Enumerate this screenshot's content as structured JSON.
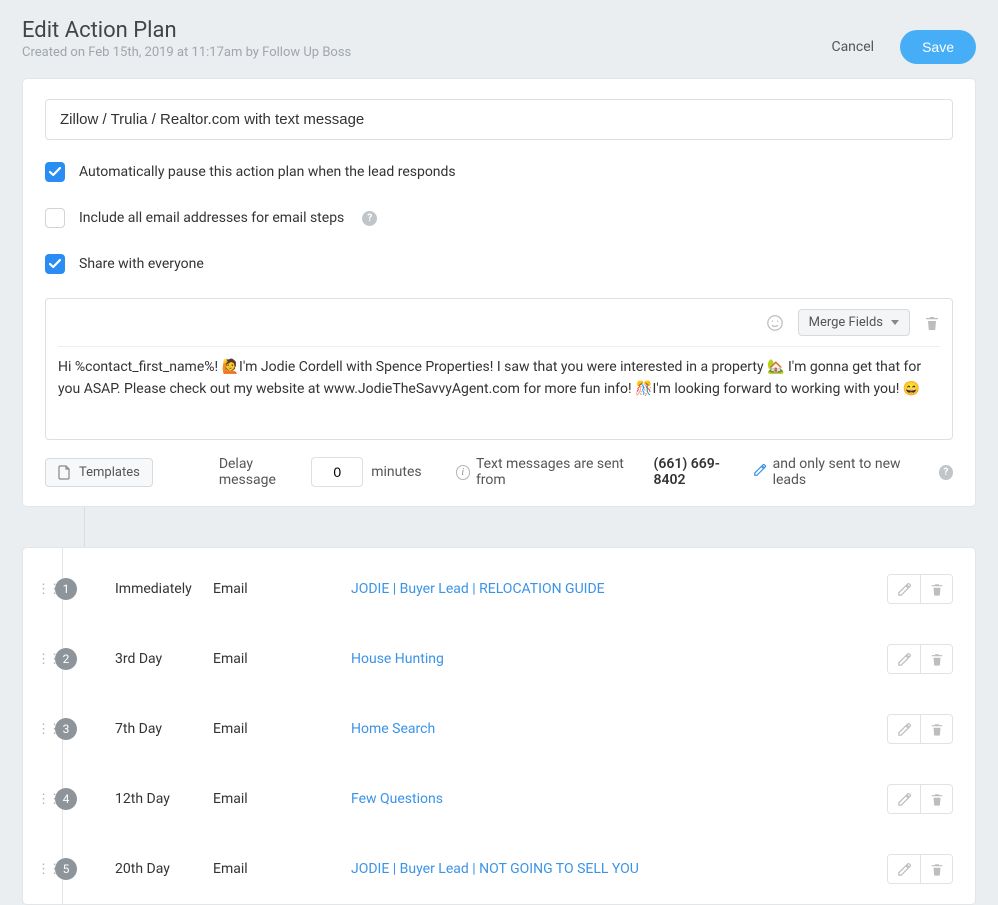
{
  "header": {
    "title": "Edit Action Plan",
    "created": "Created on Feb 15th, 2019 at 11:17am by Follow Up Boss",
    "cancel": "Cancel",
    "save": "Save"
  },
  "form": {
    "name_value": "Zillow / Trulia / Realtor.com with text message",
    "option_pause": "Automatically pause this action plan when the lead responds",
    "option_emails": "Include all email addresses for email steps",
    "option_share": "Share with everyone"
  },
  "editor": {
    "merge_label": "Merge Fields",
    "message": "Hi %contact_first_name%! 🙋I'm Jodie Cordell with Spence Properties! I saw that you were interested in a property 🏡 I'm gonna get that for you ASAP. Please check out my website at www.JodieTheSavvyAgent.com for more fun info! 🎊I'm looking forward to working with you! 😄"
  },
  "bottom": {
    "templates": "Templates",
    "delay_label": "Delay message",
    "delay_value": "0",
    "delay_unit": "minutes",
    "info_pre": "Text messages are sent from",
    "phone": "(661) 669-8402",
    "info_post": "and only sent to new leads"
  },
  "steps": [
    {
      "num": "1",
      "timing": "Immediately",
      "type": "Email",
      "title": "JODIE | Buyer Lead | RELOCATION GUIDE"
    },
    {
      "num": "2",
      "timing": "3rd Day",
      "type": "Email",
      "title": "House Hunting"
    },
    {
      "num": "3",
      "timing": "7th Day",
      "type": "Email",
      "title": "Home Search"
    },
    {
      "num": "4",
      "timing": "12th Day",
      "type": "Email",
      "title": "Few Questions"
    },
    {
      "num": "5",
      "timing": "20th Day",
      "type": "Email",
      "title": "JODIE | Buyer Lead | NOT GOING TO SELL YOU"
    }
  ]
}
